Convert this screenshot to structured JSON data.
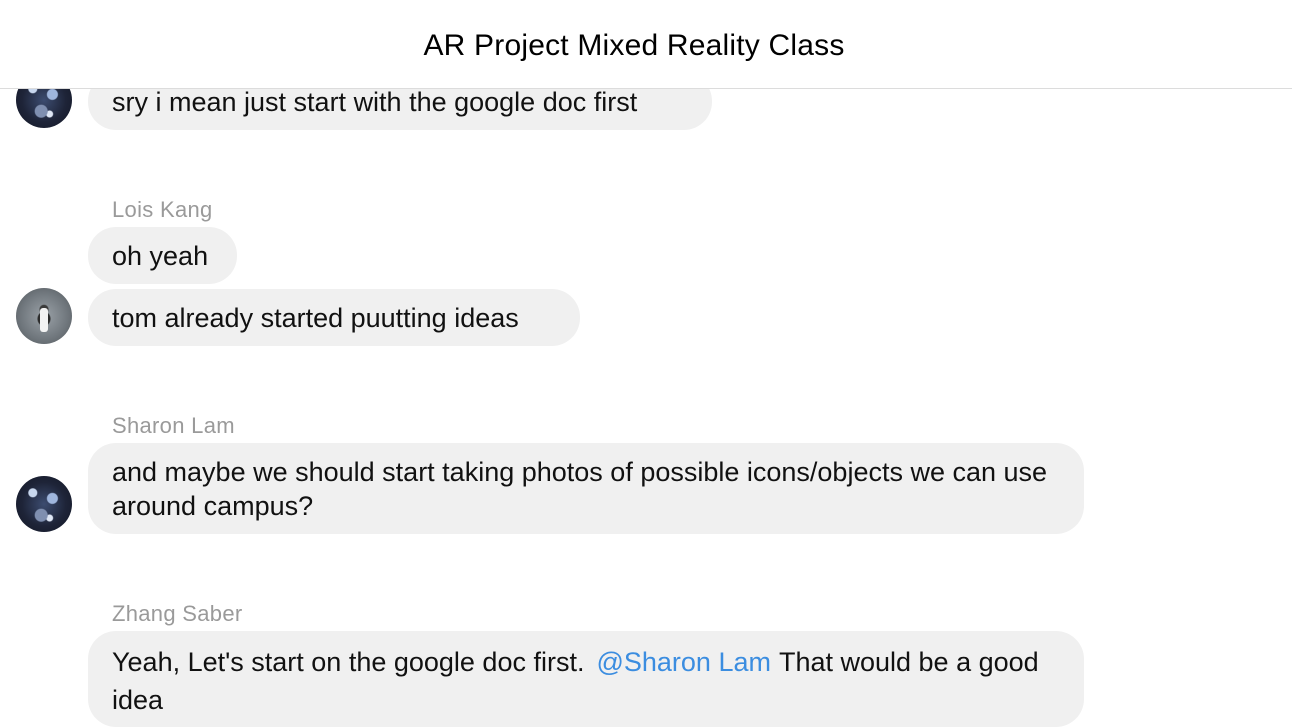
{
  "header": {
    "title": "AR Project Mixed Reality Class"
  },
  "messages": {
    "m1": {
      "text": "sry i mean just start with the google doc first"
    },
    "lois": {
      "sender": "Lois Kang",
      "line1": "oh yeah",
      "line2": "tom already started puutting ideas"
    },
    "sharon": {
      "sender": "Sharon Lam",
      "text": "and maybe we should start taking photos of possible icons/objects we can use around campus?"
    },
    "zhang": {
      "sender": "Zhang Saber",
      "text_before": "Yeah, Let's start on the google doc first.",
      "mention": "@Sharon Lam",
      "text_after": "That would be a good idea"
    }
  },
  "colors": {
    "bubble": "#f0f0f0",
    "sender_name": "#9a9a9a",
    "mention": "#3b8de0"
  }
}
